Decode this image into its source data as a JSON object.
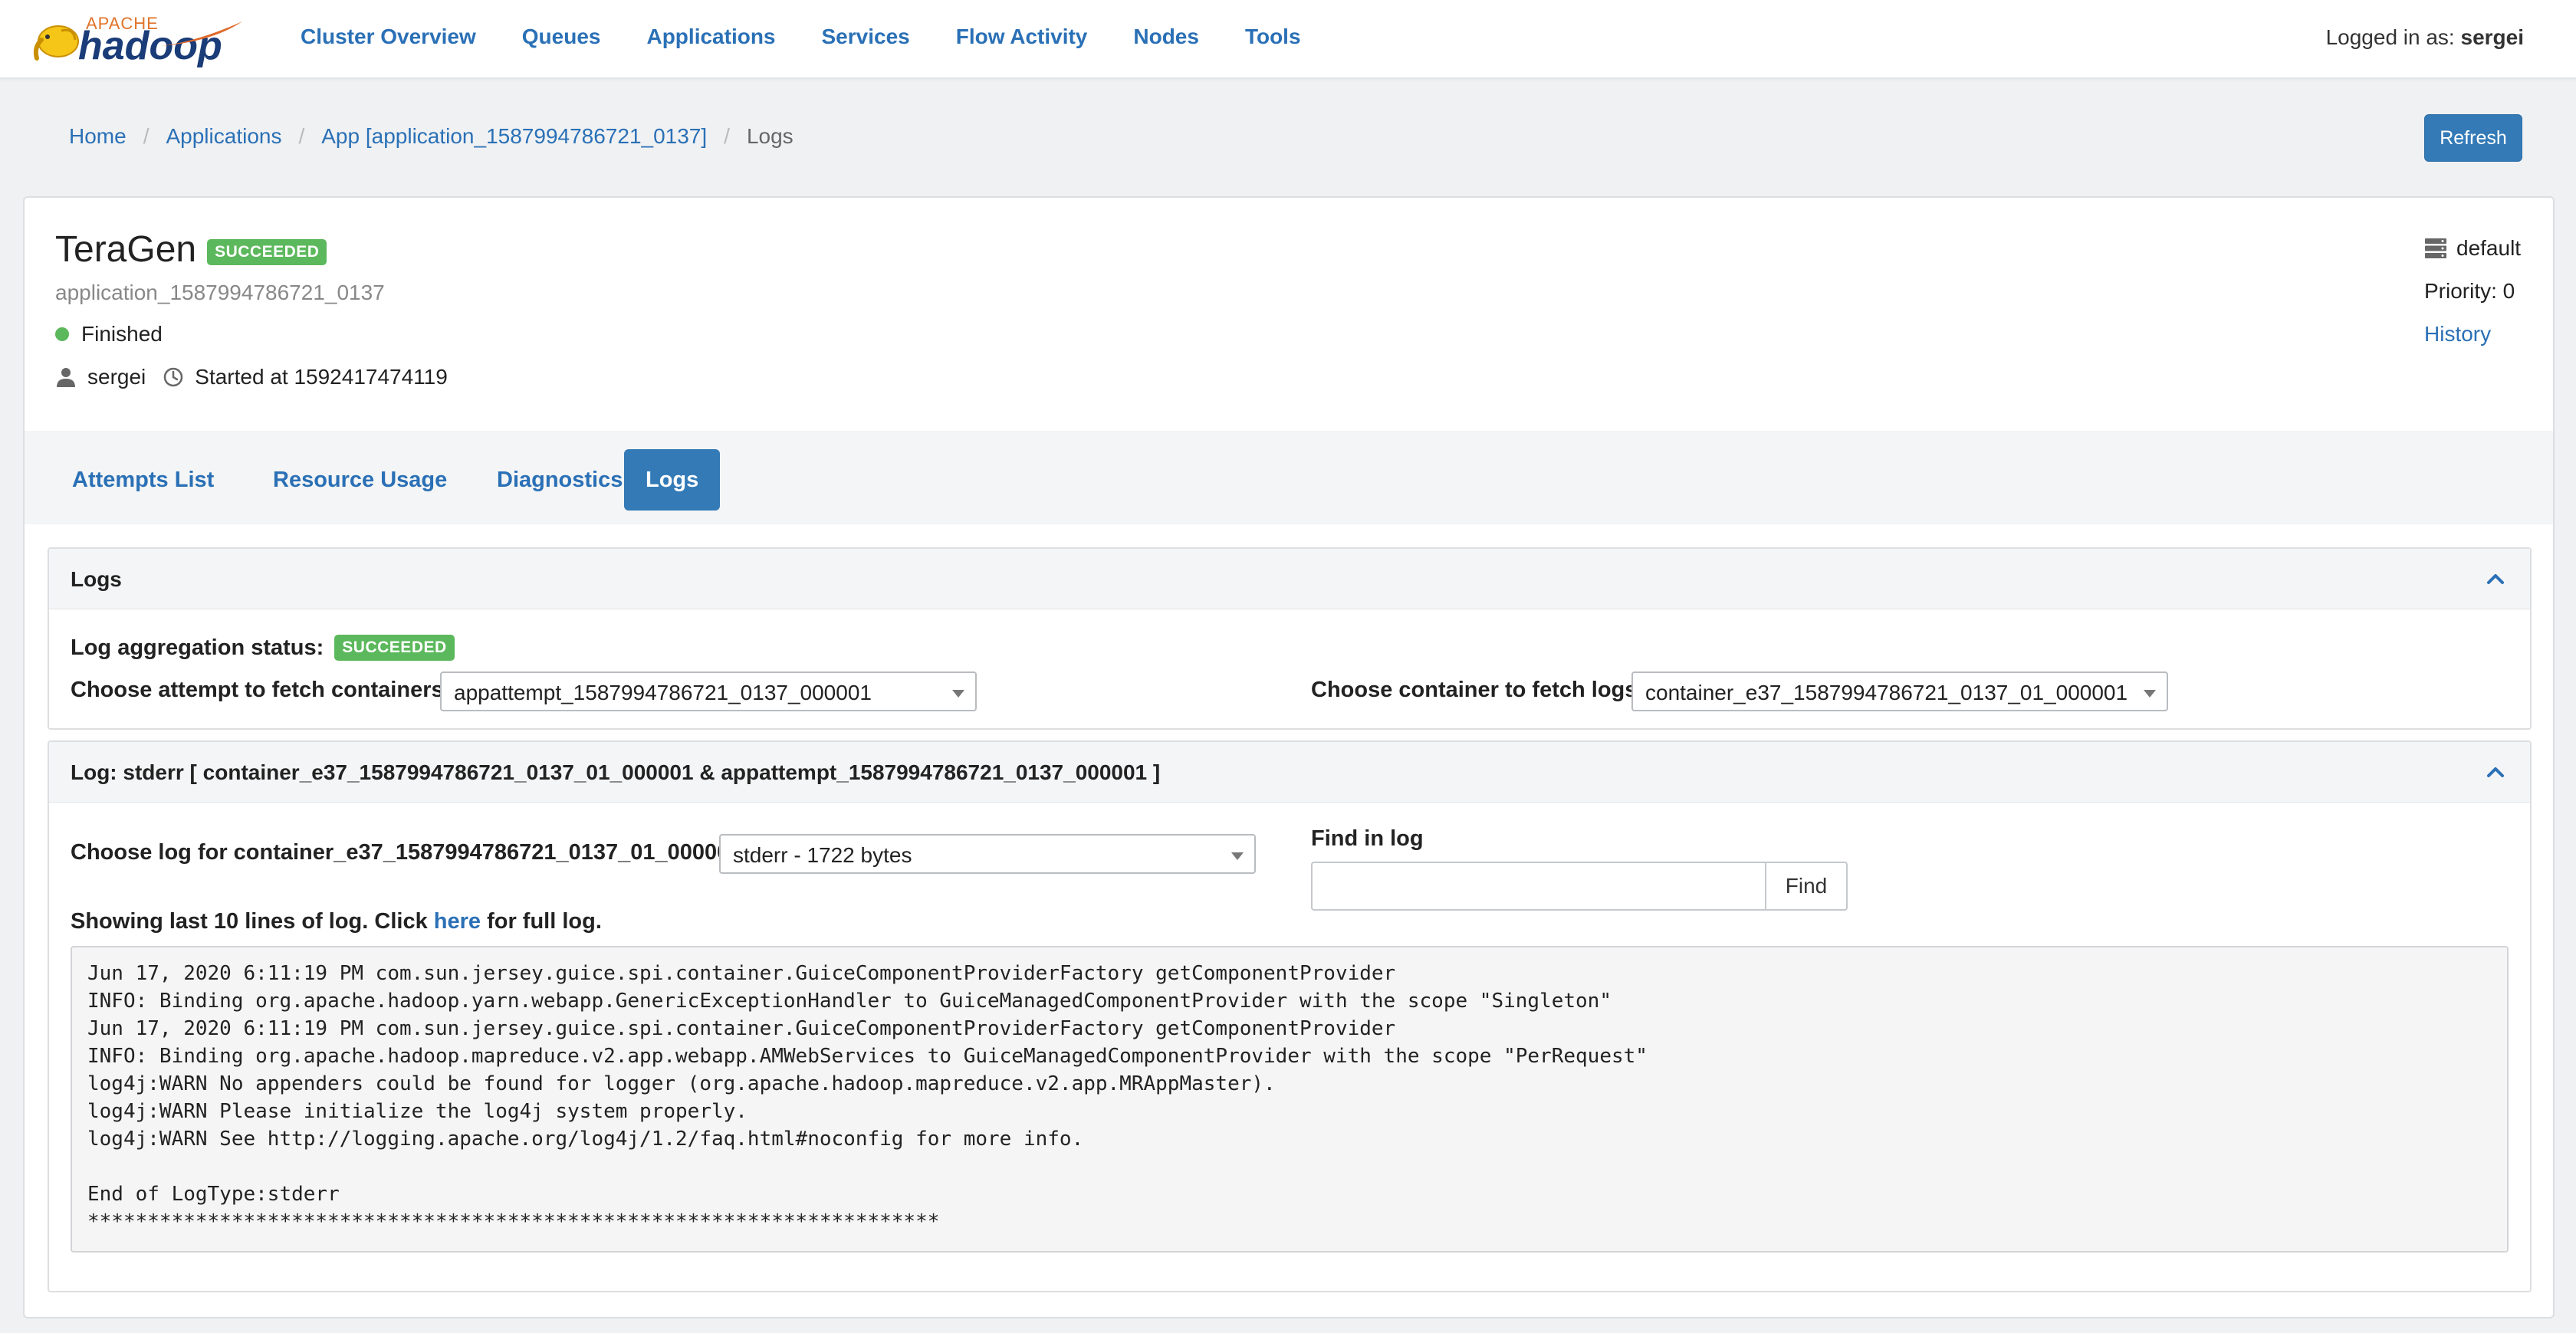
{
  "navbar": {
    "logo_top": "APACHE",
    "logo_main": "hadoop",
    "items": [
      {
        "label": "Cluster Overview"
      },
      {
        "label": "Queues"
      },
      {
        "label": "Applications"
      },
      {
        "label": "Services"
      },
      {
        "label": "Flow Activity"
      },
      {
        "label": "Nodes"
      },
      {
        "label": "Tools"
      }
    ],
    "logged_prefix": "Logged in as:",
    "user": "sergei"
  },
  "breadcrumb": [
    {
      "label": "Home"
    },
    {
      "label": "Applications"
    },
    {
      "label": "App [application_1587994786721_0137]"
    },
    {
      "label": "Logs"
    }
  ],
  "refresh_label": "Refresh",
  "app": {
    "name": "TeraGen",
    "status_badge": "SUCCEEDED",
    "id": "application_1587994786721_0137",
    "state": "Finished",
    "user": "sergei",
    "started": "Started at 1592417474119",
    "queue": "default",
    "priority": "Priority: 0",
    "history_label": "History",
    "colors": {
      "success": "#5cb85c",
      "primary": "#337ab7",
      "link": "#2a70b6"
    }
  },
  "tabs": [
    {
      "label": "Attempts List"
    },
    {
      "label": "Resource Usage"
    },
    {
      "label": "Diagnostics"
    },
    {
      "label": "Logs"
    }
  ],
  "logs_panel": {
    "title": "Logs",
    "aggregation_label": "Log aggregation status:",
    "aggregation_status": "SUCCEEDED",
    "attempt_label": "Choose attempt to fetch containers",
    "attempt_value": "appattempt_1587994786721_0137_000001",
    "container_label": "Choose container to fetch logs",
    "container_value": "container_e37_1587994786721_0137_01_000001"
  },
  "log_panel": {
    "title": "Log: stderr [ container_e37_1587994786721_0137_01_000001 & appattempt_1587994786721_0137_000001 ]",
    "choose_log_label": "Choose log for container_e37_1587994786721_0137_01_000001",
    "log_value": "stderr - 1722 bytes",
    "find_label": "Find in log",
    "find_value": "",
    "find_button": "Find",
    "showing_prefix": "Showing last 10 lines of log. Click",
    "showing_link": "here",
    "showing_suffix": "for full log.",
    "lines": [
      "Jun 17, 2020 6:11:19 PM com.sun.jersey.guice.spi.container.GuiceComponentProviderFactory getComponentProvider",
      "INFO: Binding org.apache.hadoop.yarn.webapp.GenericExceptionHandler to GuiceManagedComponentProvider with the scope \"Singleton\"",
      "Jun 17, 2020 6:11:19 PM com.sun.jersey.guice.spi.container.GuiceComponentProviderFactory getComponentProvider",
      "INFO: Binding org.apache.hadoop.mapreduce.v2.app.webapp.AMWebServices to GuiceManagedComponentProvider with the scope \"PerRequest\"",
      "log4j:WARN No appenders could be found for logger (org.apache.hadoop.mapreduce.v2.app.MRAppMaster).",
      "log4j:WARN Please initialize the log4j system properly.",
      "log4j:WARN See http://logging.apache.org/log4j/1.2/faq.html#noconfig for more info.",
      "",
      "End of LogType:stderr",
      "***********************************************************************"
    ]
  }
}
